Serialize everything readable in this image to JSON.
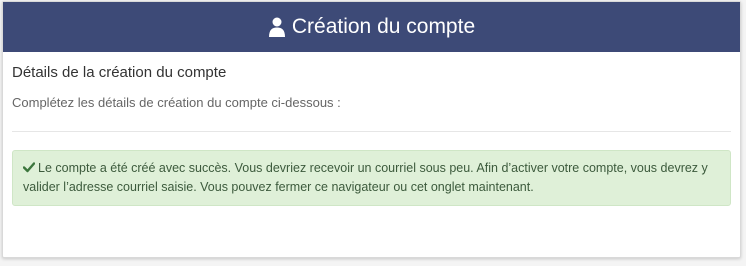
{
  "header": {
    "title": "Création du compte",
    "icon": "user-icon",
    "background_color": "#3d4a77"
  },
  "body": {
    "section_title": "Détails de la création du compte",
    "instructions": "Complétez les détails de création du compte ci-dessous :",
    "alert": {
      "icon": "check-icon",
      "type": "success",
      "message": "Le compte a été créé avec succès. Vous devriez recevoir un courriel sous peu. Afin d’activer votre compte, vous devrez y valider l’adresse courriel saisie. Vous pouvez fermer ce navigateur ou cet onglet maintenant.",
      "background_color": "#dff0d8"
    }
  }
}
